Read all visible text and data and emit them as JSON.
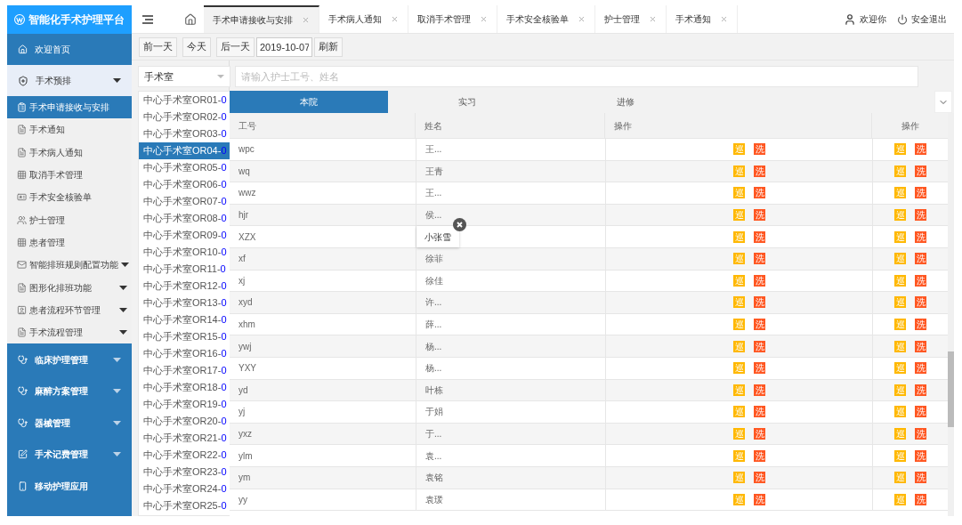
{
  "brand": {
    "title": "智能化手术护理平台"
  },
  "header": {
    "tabs": [
      {
        "label": "手术申请接收与安排",
        "selected": true
      },
      {
        "label": "手术病人通知",
        "selected": false
      },
      {
        "label": "取消手术管理",
        "selected": false
      },
      {
        "label": "手术安全核验单",
        "selected": false
      },
      {
        "label": "护士管理",
        "selected": false
      },
      {
        "label": "手术通知",
        "selected": false
      }
    ],
    "user": "欢迎你",
    "logout": "安全退出"
  },
  "sidebar": {
    "items": [
      {
        "label": "欢迎首页",
        "kind": "link",
        "selected": false
      },
      {
        "label": "手术预排",
        "kind": "group",
        "expanded": true,
        "children": [
          {
            "label": "手术申请接收与安排",
            "kind": "link",
            "selected": true
          },
          {
            "label": "手术通知",
            "kind": "link",
            "selected": false
          },
          {
            "label": "手术病人通知",
            "kind": "link",
            "selected": false
          },
          {
            "label": "取消手术管理",
            "kind": "link",
            "selected": false
          },
          {
            "label": "手术安全核验单",
            "kind": "link",
            "selected": false
          },
          {
            "label": "护士管理",
            "kind": "link",
            "selected": false
          },
          {
            "label": "患者管理",
            "kind": "link",
            "selected": false
          },
          {
            "label": "智能排班规则配置功能",
            "kind": "submenu",
            "expanded": false,
            "selected": false
          },
          {
            "label": "图形化排班功能",
            "kind": "submenu",
            "expanded": false,
            "selected": false
          },
          {
            "label": "患者流程环节管理",
            "kind": "submenu",
            "expanded": false,
            "selected": false
          },
          {
            "label": "手术流程管理",
            "kind": "submenu",
            "expanded": false,
            "selected": false
          }
        ]
      },
      {
        "label": "临床护理管理",
        "kind": "group",
        "expanded": false
      },
      {
        "label": "麻醉方案管理",
        "kind": "group",
        "expanded": false
      },
      {
        "label": "器械管理",
        "kind": "group",
        "expanded": false
      },
      {
        "label": "手术记费管理",
        "kind": "group",
        "expanded": false
      },
      {
        "label": "移动护理应用",
        "kind": "link",
        "selected": false
      }
    ]
  },
  "toolbar": {
    "buttons": [
      "前一天",
      "今天",
      "后一天"
    ],
    "date": "2019-10-07",
    "refresh": "刷新"
  },
  "rooms": {
    "select": "手术室",
    "items": [
      {
        "name": "中心手术室OR01-",
        "count": "0",
        "selected": false
      },
      {
        "name": "中心手术室OR02-",
        "count": "0",
        "selected": false
      },
      {
        "name": "中心手术室OR03-",
        "count": "0",
        "selected": false
      },
      {
        "name": "中心手术室OR04-",
        "count": "0",
        "selected": true
      },
      {
        "name": "中心手术室OR05-",
        "count": "0",
        "selected": false
      },
      {
        "name": "中心手术室OR06-",
        "count": "0",
        "selected": false
      },
      {
        "name": "中心手术室OR07-",
        "count": "0",
        "selected": false
      },
      {
        "name": "中心手术室OR08-",
        "count": "0",
        "selected": false
      },
      {
        "name": "中心手术室OR09-",
        "count": "0",
        "selected": false
      },
      {
        "name": "中心手术室OR10-",
        "count": "0",
        "selected": false
      },
      {
        "name": "中心手术室OR11-",
        "count": "0",
        "selected": false
      },
      {
        "name": "中心手术室OR12-",
        "count": "0",
        "selected": false
      },
      {
        "name": "中心手术室OR13-",
        "count": "0",
        "selected": false
      },
      {
        "name": "中心手术室OR14-",
        "count": "0",
        "selected": false
      },
      {
        "name": "中心手术室OR15-",
        "count": "0",
        "selected": false
      },
      {
        "name": "中心手术室OR16-",
        "count": "0",
        "selected": false
      },
      {
        "name": "中心手术室OR17-",
        "count": "0",
        "selected": false
      },
      {
        "name": "中心手术室OR18-",
        "count": "0",
        "selected": false
      },
      {
        "name": "中心手术室OR19-",
        "count": "0",
        "selected": false
      },
      {
        "name": "中心手术室OR20-",
        "count": "0",
        "selected": false
      },
      {
        "name": "中心手术室OR21-",
        "count": "0",
        "selected": false
      },
      {
        "name": "中心手术室OR22-",
        "count": "0",
        "selected": false
      },
      {
        "name": "中心手术室OR23-",
        "count": "0",
        "selected": false
      },
      {
        "name": "中心手术室OR24-",
        "count": "0",
        "selected": false
      },
      {
        "name": "中心手术室OR25-",
        "count": "0",
        "selected": false
      }
    ]
  },
  "search": {
    "placeholder": "请输入护士工号、姓名"
  },
  "staff_tabs": [
    {
      "label": "本院",
      "selected": true
    },
    {
      "label": "实习",
      "selected": false
    },
    {
      "label": "进修",
      "selected": false
    }
  ],
  "table": {
    "columns": [
      "工号",
      "姓名",
      "操作",
      "操作"
    ],
    "rows": [
      {
        "id": "wpc",
        "name": "王...",
        "popup": false,
        "actions": [
          {
            "label": "巡",
            "color": "#ffb800"
          },
          {
            "label": "洗",
            "color": "#ff5722"
          }
        ],
        "fixed_actions": [
          {
            "label": "巡",
            "color": "#ffb800"
          },
          {
            "label": "洗",
            "color": "#ff5722"
          }
        ]
      },
      {
        "id": "wq",
        "name": "王青",
        "popup": false,
        "actions": [
          {
            "label": "巡",
            "color": "#ffb800"
          },
          {
            "label": "洗",
            "color": "#ff5722"
          }
        ],
        "fixed_actions": [
          {
            "label": "巡",
            "color": "#ffb800"
          },
          {
            "label": "洗",
            "color": "#ff5722"
          }
        ]
      },
      {
        "id": "wwz",
        "name": "王...",
        "popup": false,
        "actions": [
          {
            "label": "巡",
            "color": "#ffb800"
          },
          {
            "label": "洗",
            "color": "#ff5722"
          }
        ],
        "fixed_actions": [
          {
            "label": "巡",
            "color": "#ffb800"
          },
          {
            "label": "洗",
            "color": "#ff5722"
          }
        ]
      },
      {
        "id": "hjr",
        "name": "侯...",
        "popup": false,
        "actions": [
          {
            "label": "巡",
            "color": "#ffb800"
          },
          {
            "label": "洗",
            "color": "#ff5722"
          }
        ],
        "fixed_actions": [
          {
            "label": "巡",
            "color": "#ffb800"
          },
          {
            "label": "洗",
            "color": "#ff5722"
          }
        ]
      },
      {
        "id": "XZX",
        "name": "小张雪",
        "popup": true,
        "actions": [
          {
            "label": "巡",
            "color": "#ffb800"
          },
          {
            "label": "洗",
            "color": "#ff5722"
          }
        ],
        "fixed_actions": [
          {
            "label": "巡",
            "color": "#ffb800"
          },
          {
            "label": "洗",
            "color": "#ff5722"
          }
        ]
      },
      {
        "id": "xf",
        "name": "徐菲",
        "popup": false,
        "actions": [
          {
            "label": "巡",
            "color": "#ffb800"
          },
          {
            "label": "洗",
            "color": "#ff5722"
          }
        ],
        "fixed_actions": [
          {
            "label": "巡",
            "color": "#ffb800"
          },
          {
            "label": "洗",
            "color": "#ff5722"
          }
        ]
      },
      {
        "id": "xj",
        "name": "徐佳",
        "popup": false,
        "actions": [
          {
            "label": "巡",
            "color": "#ffb800"
          },
          {
            "label": "洗",
            "color": "#ff5722"
          }
        ],
        "fixed_actions": [
          {
            "label": "巡",
            "color": "#ffb800"
          },
          {
            "label": "洗",
            "color": "#ff5722"
          }
        ]
      },
      {
        "id": "xyd",
        "name": "许...",
        "popup": false,
        "actions": [
          {
            "label": "巡",
            "color": "#ffb800"
          },
          {
            "label": "洗",
            "color": "#ff5722"
          }
        ],
        "fixed_actions": [
          {
            "label": "巡",
            "color": "#ffb800"
          },
          {
            "label": "洗",
            "color": "#ff5722"
          }
        ]
      },
      {
        "id": "xhm",
        "name": "薛...",
        "popup": false,
        "actions": [
          {
            "label": "巡",
            "color": "#ffb800"
          },
          {
            "label": "洗",
            "color": "#ff5722"
          }
        ],
        "fixed_actions": [
          {
            "label": "巡",
            "color": "#ffb800"
          },
          {
            "label": "洗",
            "color": "#ff5722"
          }
        ]
      },
      {
        "id": "ywj",
        "name": "杨...",
        "popup": false,
        "actions": [
          {
            "label": "巡",
            "color": "#ffb800"
          },
          {
            "label": "洗",
            "color": "#ff5722"
          }
        ],
        "fixed_actions": [
          {
            "label": "巡",
            "color": "#ffb800"
          },
          {
            "label": "洗",
            "color": "#ff5722"
          }
        ]
      },
      {
        "id": "YXY",
        "name": "杨...",
        "popup": false,
        "actions": [
          {
            "label": "巡",
            "color": "#ffb800"
          },
          {
            "label": "洗",
            "color": "#ff5722"
          }
        ],
        "fixed_actions": [
          {
            "label": "巡",
            "color": "#ffb800"
          },
          {
            "label": "洗",
            "color": "#ff5722"
          }
        ]
      },
      {
        "id": "yd",
        "name": "叶栋",
        "popup": false,
        "actions": [
          {
            "label": "巡",
            "color": "#ffb800"
          },
          {
            "label": "洗",
            "color": "#ff5722"
          }
        ],
        "fixed_actions": [
          {
            "label": "巡",
            "color": "#ffb800"
          },
          {
            "label": "洗",
            "color": "#ff5722"
          }
        ]
      },
      {
        "id": "yj",
        "name": "于娟",
        "popup": false,
        "actions": [
          {
            "label": "巡",
            "color": "#ffb800"
          },
          {
            "label": "洗",
            "color": "#ff5722"
          }
        ],
        "fixed_actions": [
          {
            "label": "巡",
            "color": "#ffb800"
          },
          {
            "label": "洗",
            "color": "#ff5722"
          }
        ]
      },
      {
        "id": "yxz",
        "name": "于...",
        "popup": false,
        "actions": [
          {
            "label": "巡",
            "color": "#ffb800"
          },
          {
            "label": "洗",
            "color": "#ff5722"
          }
        ],
        "fixed_actions": [
          {
            "label": "巡",
            "color": "#ffb800"
          },
          {
            "label": "洗",
            "color": "#ff5722"
          }
        ]
      },
      {
        "id": "ylm",
        "name": "袁...",
        "popup": false,
        "actions": [
          {
            "label": "巡",
            "color": "#ffb800"
          },
          {
            "label": "洗",
            "color": "#ff5722"
          }
        ],
        "fixed_actions": [
          {
            "label": "巡",
            "color": "#ffb800"
          },
          {
            "label": "洗",
            "color": "#ff5722"
          }
        ]
      },
      {
        "id": "ym",
        "name": "袁铭",
        "popup": false,
        "actions": [
          {
            "label": "巡",
            "color": "#ffb800"
          },
          {
            "label": "洗",
            "color": "#ff5722"
          }
        ],
        "fixed_actions": [
          {
            "label": "巡",
            "color": "#ffb800"
          },
          {
            "label": "洗",
            "color": "#ff5722"
          }
        ]
      },
      {
        "id": "yy",
        "name": "袁瑗",
        "popup": false,
        "actions": [
          {
            "label": "巡",
            "color": "#ffb800"
          },
          {
            "label": "洗",
            "color": "#ff5722"
          }
        ],
        "fixed_actions": [
          {
            "label": "巡",
            "color": "#ffb800"
          },
          {
            "label": "洗",
            "color": "#ff5722"
          }
        ]
      }
    ]
  }
}
